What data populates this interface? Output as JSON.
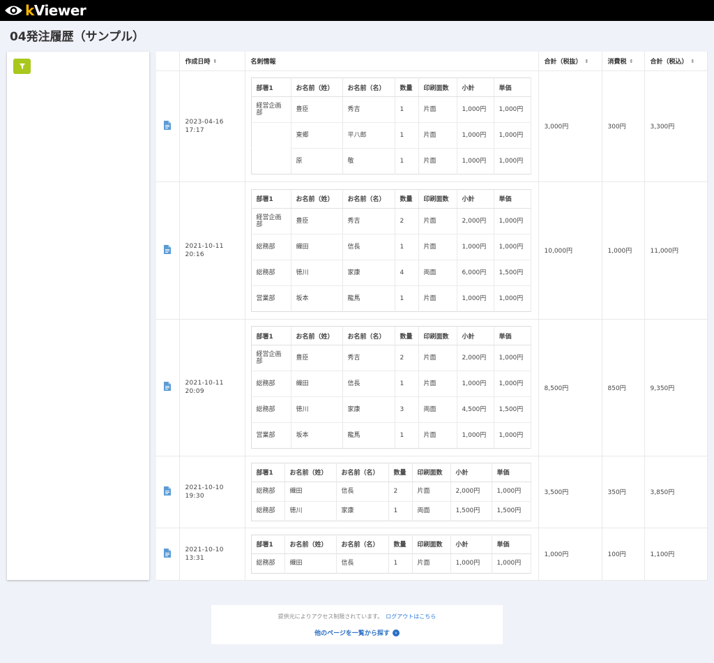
{
  "app": {
    "logo_k": "k",
    "logo_rest": "Viewer",
    "logo_color": "#f5b400"
  },
  "page": {
    "title": "04発注履歴（サンプル）"
  },
  "columns": {
    "created": "作成日時",
    "card_info": "名刺情報",
    "total_ex": "合計（税抜）",
    "tax": "消費税",
    "total_in": "合計（税込）"
  },
  "sub_headers": {
    "dept": "部署1",
    "last": "お名前（姓）",
    "first": "お名前（名）",
    "qty": "数量",
    "sides": "印刷面数",
    "subtotal": "小計",
    "unit": "単価"
  },
  "rows": [
    {
      "date": "2023-04-16",
      "time": "17:17",
      "total_ex": "3,000円",
      "tax": "300円",
      "total_in": "3,300円",
      "items": [
        {
          "dept": "経営企画部",
          "last": "豊臣",
          "first": "秀吉",
          "qty": "1",
          "sides": "片面",
          "subtotal": "1,000円",
          "unit": "1,000円"
        },
        {
          "dept": "",
          "last": "東郷",
          "first": "平八郎",
          "qty": "1",
          "sides": "片面",
          "subtotal": "1,000円",
          "unit": "1,000円"
        },
        {
          "dept": "",
          "last": "原",
          "first": "敬",
          "qty": "1",
          "sides": "片面",
          "subtotal": "1,000円",
          "unit": "1,000円"
        }
      ]
    },
    {
      "date": "2021-10-11",
      "time": "20:16",
      "total_ex": "10,000円",
      "tax": "1,000円",
      "total_in": "11,000円",
      "items": [
        {
          "dept": "経営企画部",
          "last": "豊臣",
          "first": "秀吉",
          "qty": "2",
          "sides": "片面",
          "subtotal": "2,000円",
          "unit": "1,000円"
        },
        {
          "dept": "総務部",
          "last": "織田",
          "first": "信長",
          "qty": "1",
          "sides": "片面",
          "subtotal": "1,000円",
          "unit": "1,000円"
        },
        {
          "dept": "総務部",
          "last": "徳川",
          "first": "家康",
          "qty": "4",
          "sides": "両面",
          "subtotal": "6,000円",
          "unit": "1,500円"
        },
        {
          "dept": "営業部",
          "last": "坂本",
          "first": "龍馬",
          "qty": "1",
          "sides": "片面",
          "subtotal": "1,000円",
          "unit": "1,000円"
        }
      ]
    },
    {
      "date": "2021-10-11",
      "time": "20:09",
      "total_ex": "8,500円",
      "tax": "850円",
      "total_in": "9,350円",
      "items": [
        {
          "dept": "経営企画部",
          "last": "豊臣",
          "first": "秀吉",
          "qty": "2",
          "sides": "片面",
          "subtotal": "2,000円",
          "unit": "1,000円"
        },
        {
          "dept": "総務部",
          "last": "織田",
          "first": "信長",
          "qty": "1",
          "sides": "片面",
          "subtotal": "1,000円",
          "unit": "1,000円"
        },
        {
          "dept": "総務部",
          "last": "徳川",
          "first": "家康",
          "qty": "3",
          "sides": "両面",
          "subtotal": "4,500円",
          "unit": "1,500円"
        },
        {
          "dept": "営業部",
          "last": "坂本",
          "first": "龍馬",
          "qty": "1",
          "sides": "片面",
          "subtotal": "1,000円",
          "unit": "1,000円"
        }
      ]
    },
    {
      "date": "2021-10-10",
      "time": "19:30",
      "total_ex": "3,500円",
      "tax": "350円",
      "total_in": "3,850円",
      "items": [
        {
          "dept": "総務部",
          "last": "織田",
          "first": "信長",
          "qty": "2",
          "sides": "片面",
          "subtotal": "2,000円",
          "unit": "1,000円"
        },
        {
          "dept": "総務部",
          "last": "徳川",
          "first": "家康",
          "qty": "1",
          "sides": "両面",
          "subtotal": "1,500円",
          "unit": "1,500円"
        }
      ]
    },
    {
      "date": "2021-10-10",
      "time": "13:31",
      "total_ex": "1,000円",
      "tax": "100円",
      "total_in": "1,100円",
      "items": [
        {
          "dept": "総務部",
          "last": "織田",
          "first": "信長",
          "qty": "1",
          "sides": "片面",
          "subtotal": "1,000円",
          "unit": "1,000円"
        }
      ]
    }
  ],
  "footer": {
    "notice": "提供元によりアクセス制限されています。",
    "logout": "ログアウトはこちら",
    "browse": "他のページを一覧から探す"
  },
  "colors": {
    "filter_button": "#a8c81c",
    "doc_icon": "#5b9bd5",
    "link": "#2a7bd8"
  },
  "icons": {
    "filter": "filter-icon",
    "document": "document-icon",
    "eye": "eye-logo-icon",
    "arrow": "arrow-right-circle-icon"
  }
}
